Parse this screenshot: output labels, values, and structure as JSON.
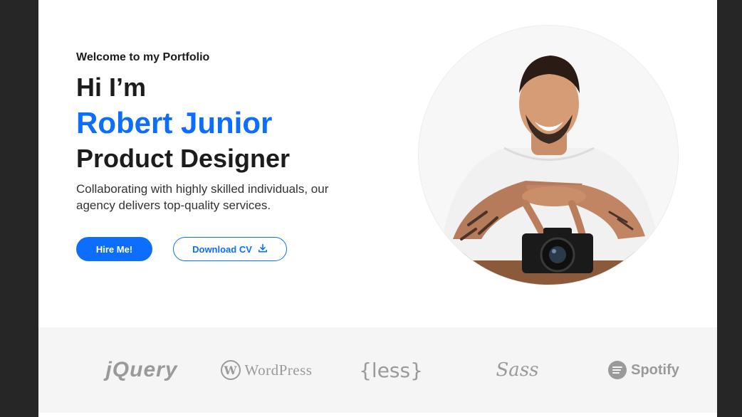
{
  "hero": {
    "welcome": "Welcome to my Portfolio",
    "greeting": "Hi I’m",
    "name": "Robert Junior",
    "role": "Product Designer",
    "description": "Collaborating with highly skilled individuals, our agency delivers top-quality services.",
    "hire_label": "Hire Me!",
    "download_label": "Download CV"
  },
  "brands": {
    "jquery": "jQuery",
    "wordpress_mark": "W",
    "wordpress": "WordPress",
    "less": "{less}",
    "sass": "Sass",
    "spotify": "Spotify"
  },
  "colors": {
    "accent": "#0d6efd",
    "heading": "#1c1c1c",
    "logo_gray": "#9a9a9a",
    "band": "#f5f5f5"
  },
  "icons": {
    "download": "download-icon",
    "wordpress": "wordpress-logo-icon",
    "spotify": "spotify-logo-icon"
  }
}
